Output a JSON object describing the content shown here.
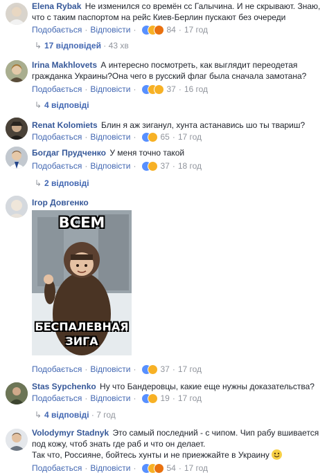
{
  "actions": {
    "like": "Подобається",
    "reply": "Відповісти",
    "sep": "·"
  },
  "comments": [
    {
      "author": "Elena Rybak",
      "text": "Не изменился со времён сс Галычина. И не скрывают. Знаю, что с таким паспортом на рейс Киев-Берлин пускают без очереди",
      "reactions": 84,
      "time": "17 год",
      "replies": "17 відповідей",
      "replies_time": "43 хв"
    },
    {
      "author": "Irina Makhlovets",
      "text": "А интересно посмотреть, как выглядит переодетая гражданка Украины?Она чего в русский флаг была сначала замотана?",
      "reactions": 37,
      "time": "16 год",
      "replies": "4 відповіді"
    },
    {
      "author": "Renat Kolomiets",
      "text": "Блин я аж зиганул, хунта астанавись шо ты твариш?",
      "reactions": 65,
      "time": "17 год"
    },
    {
      "author": "Богдаг Прудченко",
      "text": "У меня точно такой",
      "reactions": 37,
      "time": "18 год",
      "replies": "2 відповіді"
    },
    {
      "author": "Ігор Довгенко",
      "text": "",
      "meme_top": "ВСЕМ",
      "meme_bottom": "БЕСПАЛЕВНАЯ ЗИГА",
      "reactions": 37,
      "time": "17 год"
    },
    {
      "author": "Stas Sypchenko",
      "text": "Ну что Бандеровцы, какие еще нужны доказательства?",
      "reactions": 19,
      "time": "17 год",
      "replies": "4 відповіді",
      "replies_time": "7 год"
    },
    {
      "author": "Volodymyr Stadnyk",
      "text": "Это самый последний - с чипом. Чип рабу вшивается под кожу, чтоб знать где раб и что он делает.",
      "text2": "Так что, Россияне, бойтесь хунты и не приежжайте в Украину",
      "reactions": 54,
      "time": "17 год"
    }
  ],
  "colors": {
    "link": "#365899",
    "action": "#4267b2",
    "meta": "#90949c",
    "like": "#5890ff",
    "haha": "#f7b125",
    "angry": "#e9710f"
  }
}
